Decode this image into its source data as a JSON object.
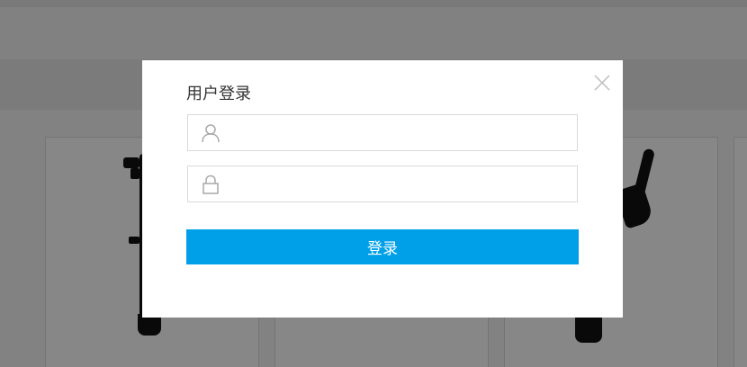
{
  "modal": {
    "title": "用户登录",
    "username": {
      "value": "",
      "placeholder": ""
    },
    "password": {
      "value": "",
      "placeholder": ""
    },
    "submit_label": "登录"
  },
  "icons": {
    "close": "close-icon",
    "user": "user-icon",
    "lock": "lock-icon"
  },
  "colors": {
    "accent": "#00a0e9",
    "overlay": "rgba(0,0,0,0.47)",
    "modal_bg": "#ffffff"
  }
}
